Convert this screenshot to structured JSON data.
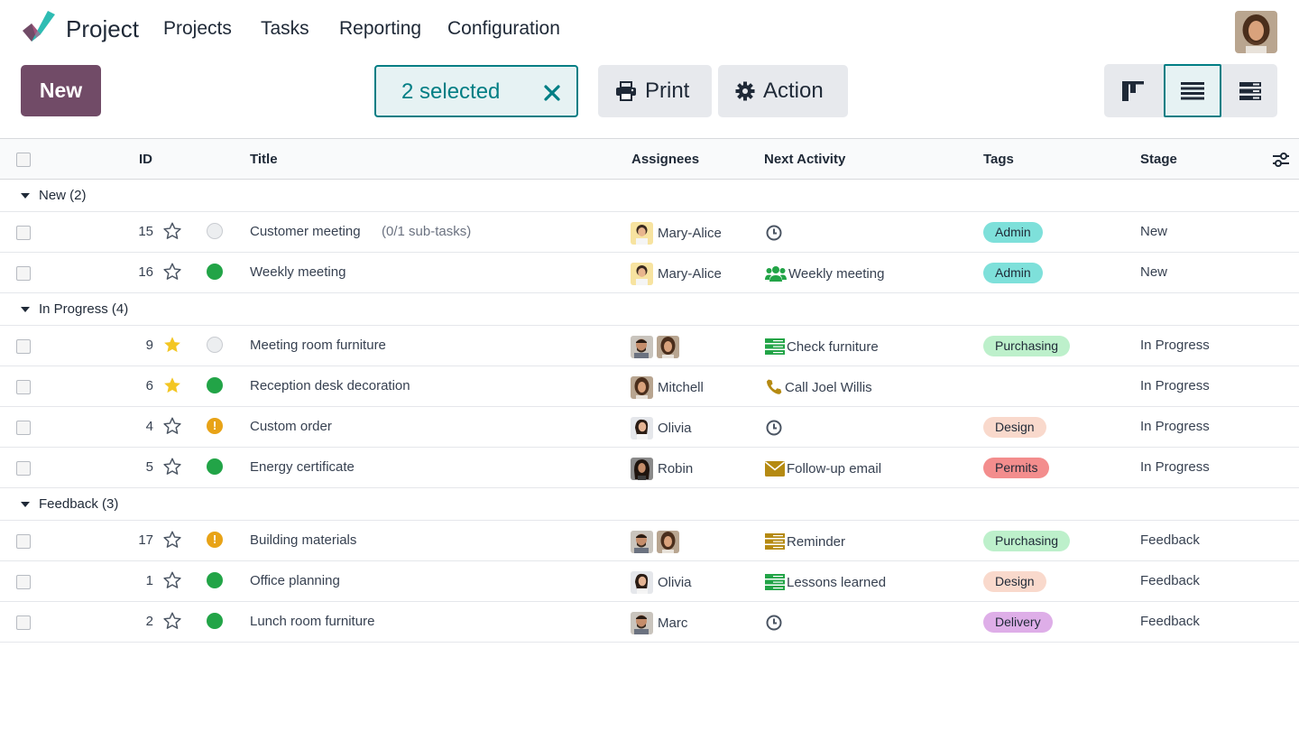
{
  "app": {
    "name": "Project",
    "menu": [
      "Projects",
      "Tasks",
      "Reporting",
      "Configuration"
    ]
  },
  "controls": {
    "new_label": "New",
    "selected_label": "2 selected",
    "print_label": "Print",
    "action_label": "Action",
    "active_view": "list"
  },
  "colors": {
    "brand": "#714b67",
    "accent": "#017e84",
    "status_green": "#22a447",
    "status_orange": "#e8a317",
    "star_gold": "#f3c623"
  },
  "table": {
    "headers": [
      "ID",
      "Title",
      "Assignees",
      "Next Activity",
      "Tags",
      "Stage"
    ],
    "groups": [
      {
        "label": "New (2)",
        "rows": [
          {
            "id": "15",
            "starred": false,
            "status": "grey",
            "title": "Customer meeting",
            "subtitle": "(0/1 sub-tasks)",
            "assignee_icons": [
              "avatar-maryalice"
            ],
            "assignee_name": "Mary-Alice",
            "activity_icon": "clock-icon",
            "activity": "",
            "tag": "Admin",
            "tag_color": "#7ee0da",
            "stage": "New"
          },
          {
            "id": "16",
            "starred": false,
            "status": "green",
            "title": "Weekly meeting",
            "subtitle": "",
            "assignee_icons": [
              "avatar-maryalice"
            ],
            "assignee_name": "Mary-Alice",
            "activity_icon": "users-icon",
            "activity": "Weekly meeting",
            "tag": "Admin",
            "tag_color": "#7ee0da",
            "stage": "New"
          }
        ]
      },
      {
        "label": "In Progress (4)",
        "rows": [
          {
            "id": "9",
            "starred": true,
            "status": "grey",
            "title": "Meeting room furniture",
            "subtitle": "",
            "assignee_icons": [
              "avatar-marc",
              "avatar-mitchell"
            ],
            "assignee_name": "",
            "activity_icon": "tasks-green-icon",
            "activity": "Check furniture",
            "tag": "Purchasing",
            "tag_color": "#bdf0cb",
            "stage": "In Progress"
          },
          {
            "id": "6",
            "starred": true,
            "status": "green",
            "title": "Reception desk decoration",
            "subtitle": "",
            "assignee_icons": [
              "avatar-mitchell"
            ],
            "assignee_name": "Mitchell",
            "activity_icon": "phone-icon",
            "activity": "Call Joel Willis",
            "tag": "",
            "tag_color": "",
            "stage": "In Progress"
          },
          {
            "id": "4",
            "starred": false,
            "status": "orange",
            "title": "Custom order",
            "subtitle": "",
            "assignee_icons": [
              "avatar-olivia"
            ],
            "assignee_name": "Olivia",
            "activity_icon": "clock-icon",
            "activity": "",
            "tag": "Design",
            "tag_color": "#f9d9cc",
            "stage": "In Progress"
          },
          {
            "id": "5",
            "starred": false,
            "status": "green",
            "title": "Energy certificate",
            "subtitle": "",
            "assignee_icons": [
              "avatar-robin"
            ],
            "assignee_name": "Robin",
            "activity_icon": "envelope-icon",
            "activity": "Follow-up email",
            "tag": "Permits",
            "tag_color": "#f38d8d",
            "stage": "In Progress"
          }
        ]
      },
      {
        "label": "Feedback (3)",
        "rows": [
          {
            "id": "17",
            "starred": false,
            "status": "orange",
            "title": "Building materials",
            "subtitle": "",
            "assignee_icons": [
              "avatar-marc",
              "avatar-mitchell"
            ],
            "assignee_name": "",
            "activity_icon": "tasks-gold-icon",
            "activity": "Reminder",
            "tag": "Purchasing",
            "tag_color": "#bdf0cb",
            "stage": "Feedback"
          },
          {
            "id": "1",
            "starred": false,
            "status": "green",
            "title": "Office planning",
            "subtitle": "",
            "assignee_icons": [
              "avatar-olivia"
            ],
            "assignee_name": "Olivia",
            "activity_icon": "tasks-green-icon",
            "activity": "Lessons learned",
            "tag": "Design",
            "tag_color": "#f9d9cc",
            "stage": "Feedback"
          },
          {
            "id": "2",
            "starred": false,
            "status": "green",
            "title": "Lunch room furniture",
            "subtitle": "",
            "assignee_icons": [
              "avatar-marc"
            ],
            "assignee_name": "Marc",
            "activity_icon": "clock-icon",
            "activity": "",
            "tag": "Delivery",
            "tag_color": "#deaee8",
            "stage": "Feedback"
          }
        ]
      }
    ]
  }
}
